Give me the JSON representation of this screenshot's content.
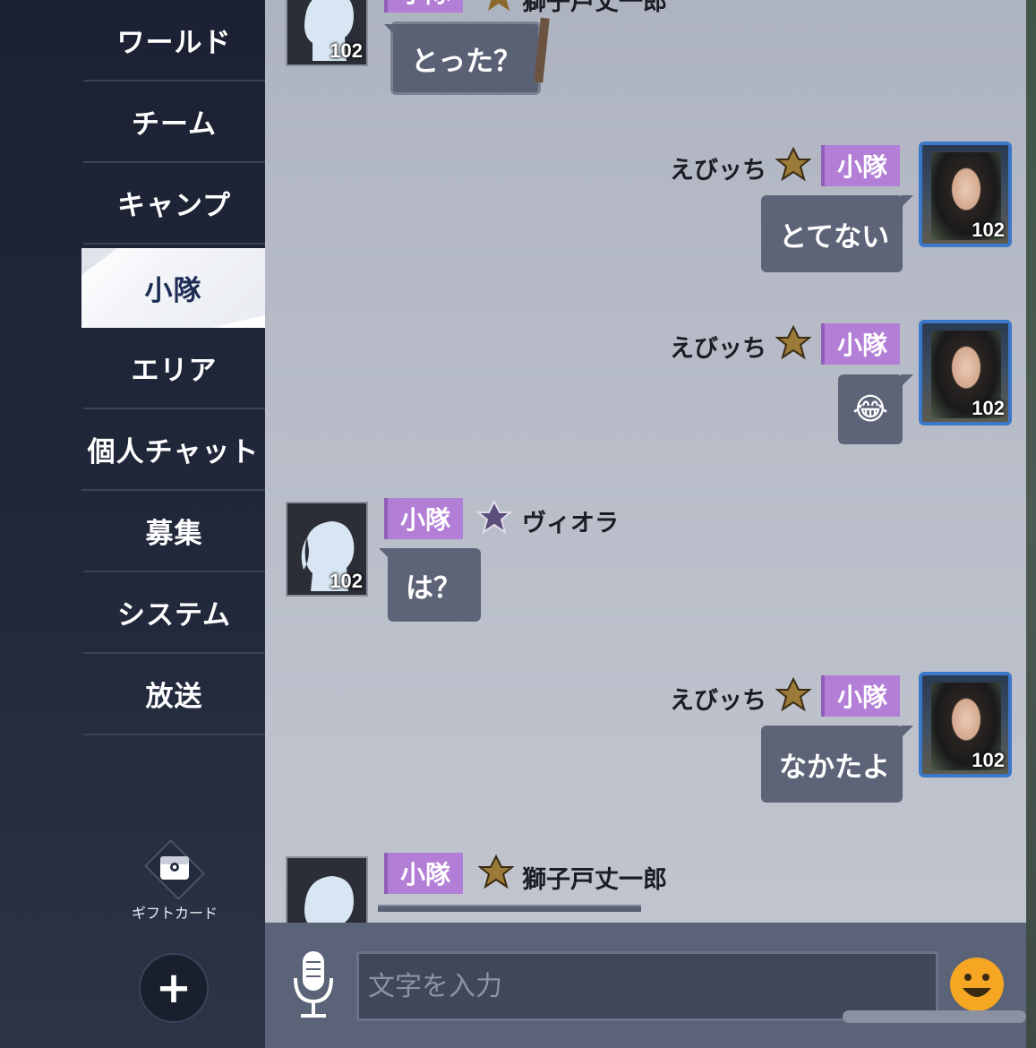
{
  "sidebar": {
    "items": [
      {
        "label": "ワールド"
      },
      {
        "label": "チーム"
      },
      {
        "label": "キャンプ"
      },
      {
        "label": "小隊",
        "active": true
      },
      {
        "label": "エリア"
      },
      {
        "label": "個人チャット"
      },
      {
        "label": "募集"
      },
      {
        "label": "システム"
      },
      {
        "label": "放送"
      }
    ],
    "gift_label": "ギフトカード",
    "plus_label": "+"
  },
  "chat": {
    "top_partial": {
      "tag": "小隊",
      "name": "獅子戸丈一郎",
      "level": "102",
      "text": "とった？"
    },
    "messages": [
      {
        "name": "えびッち",
        "tag": "小隊",
        "level": "102",
        "text": "とてない"
      },
      {
        "name": "えびッち",
        "tag": "小隊",
        "level": "102",
        "text": "😂"
      },
      {
        "name": "ヴィオラ",
        "tag": "小隊",
        "level": "102",
        "text": "は？"
      },
      {
        "name": "えびッち",
        "tag": "小隊",
        "level": "102",
        "text": "なかたよ"
      },
      {
        "name": "獅子戸丈一郎",
        "tag": "小隊",
        "level": ""
      }
    ]
  },
  "input": {
    "placeholder": "文字を入力",
    "value": ""
  },
  "colors": {
    "tag": "#b27ed6",
    "bubble": "#5d6478",
    "sidebar": "#1f2638",
    "active_text": "#1d2c55",
    "emoji_yellow": "#f5a623"
  },
  "icons": {
    "mic": "microphone-icon",
    "emoji": "smiley-face-icon",
    "gift": "gift-card-icon",
    "plus": "plus-icon"
  }
}
